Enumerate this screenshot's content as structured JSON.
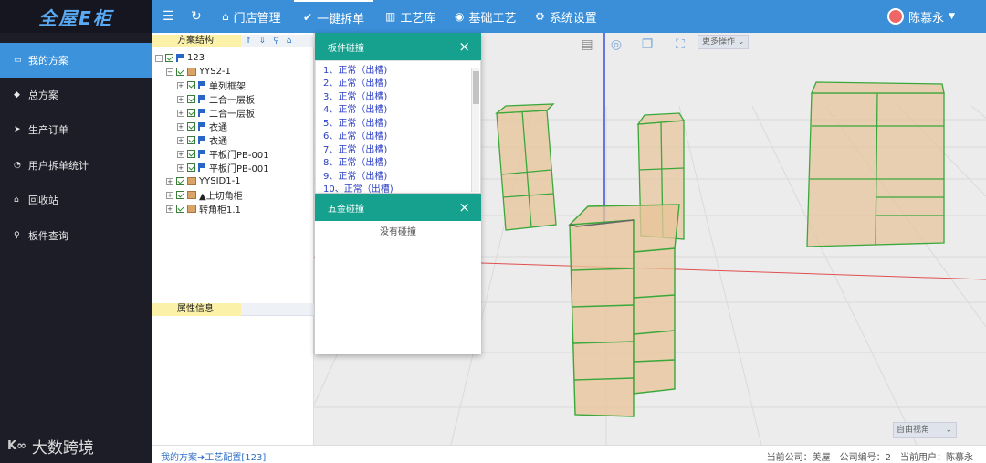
{
  "logo": {
    "text": "全屋E柜"
  },
  "header": {
    "nav": [
      {
        "label": "门店管理",
        "icon": "home-icon"
      },
      {
        "label": "一键拆单",
        "icon": "check-circle-icon"
      },
      {
        "label": "工艺库",
        "icon": "library-icon"
      },
      {
        "label": "基础工艺",
        "icon": "palette-icon"
      },
      {
        "label": "系统设置",
        "icon": "gear-icon"
      }
    ],
    "user": "陈慕永"
  },
  "sidebar": {
    "items": [
      {
        "label": "我的方案",
        "icon": "folder-icon",
        "active": true
      },
      {
        "label": "总方案",
        "icon": "diamond-icon"
      },
      {
        "label": "生产订单",
        "icon": "send-icon"
      },
      {
        "label": "用户拆单统计",
        "icon": "clock-icon"
      },
      {
        "label": "回收站",
        "icon": "bank-icon"
      },
      {
        "label": "板件查询",
        "icon": "search-icon"
      }
    ],
    "brand": "大数跨境"
  },
  "tree_panel": {
    "title": "方案结构",
    "props_title": "属性信息",
    "nodes": [
      {
        "label": "123",
        "level": 0,
        "icon": "flag"
      },
      {
        "label": "YYS2-1",
        "level": 1,
        "icon": "box"
      },
      {
        "label": "单列框架",
        "level": 2,
        "icon": "flag"
      },
      {
        "label": "二合一层板",
        "level": 2,
        "icon": "flag"
      },
      {
        "label": "二合一层板",
        "level": 2,
        "icon": "flag"
      },
      {
        "label": "衣通",
        "level": 2,
        "icon": "flag"
      },
      {
        "label": "衣通",
        "level": 2,
        "icon": "flag"
      },
      {
        "label": "平板门PB-001",
        "level": 2,
        "icon": "flag"
      },
      {
        "label": "平板门PB-001",
        "level": 2,
        "icon": "flag"
      },
      {
        "label": "YYSID1-1",
        "level": 1,
        "icon": "box"
      },
      {
        "label": "▲上切角柜",
        "level": 1,
        "icon": "box"
      },
      {
        "label": "转角柜1.1",
        "level": 1,
        "icon": "box"
      }
    ]
  },
  "viewport": {
    "more_ops": "更多操作",
    "view_angle": "自由视角",
    "colors": {
      "floor": "#ececec",
      "cabinet": "#e8c49a",
      "edge": "#3aa83a"
    }
  },
  "dialog_panel": {
    "title": "板件碰撞",
    "items": [
      "1、正常（出槽)",
      "2、正常（出槽)",
      "3、正常（出槽)",
      "4、正常（出槽)",
      "5、正常（出槽)",
      "6、正常（出槽)",
      "7、正常（出槽)",
      "8、正常（出槽)",
      "9、正常（出槽)",
      "10、正常（出槽)"
    ]
  },
  "dialog_hardware": {
    "title": "五金碰撞",
    "message": "没有碰撞"
  },
  "statusbar": {
    "breadcrumb": "我的方案➜工艺配置[123]",
    "company": "当前公司：美屋",
    "company_no": "公司编号：2",
    "user": "当前用户：陈慕永"
  }
}
